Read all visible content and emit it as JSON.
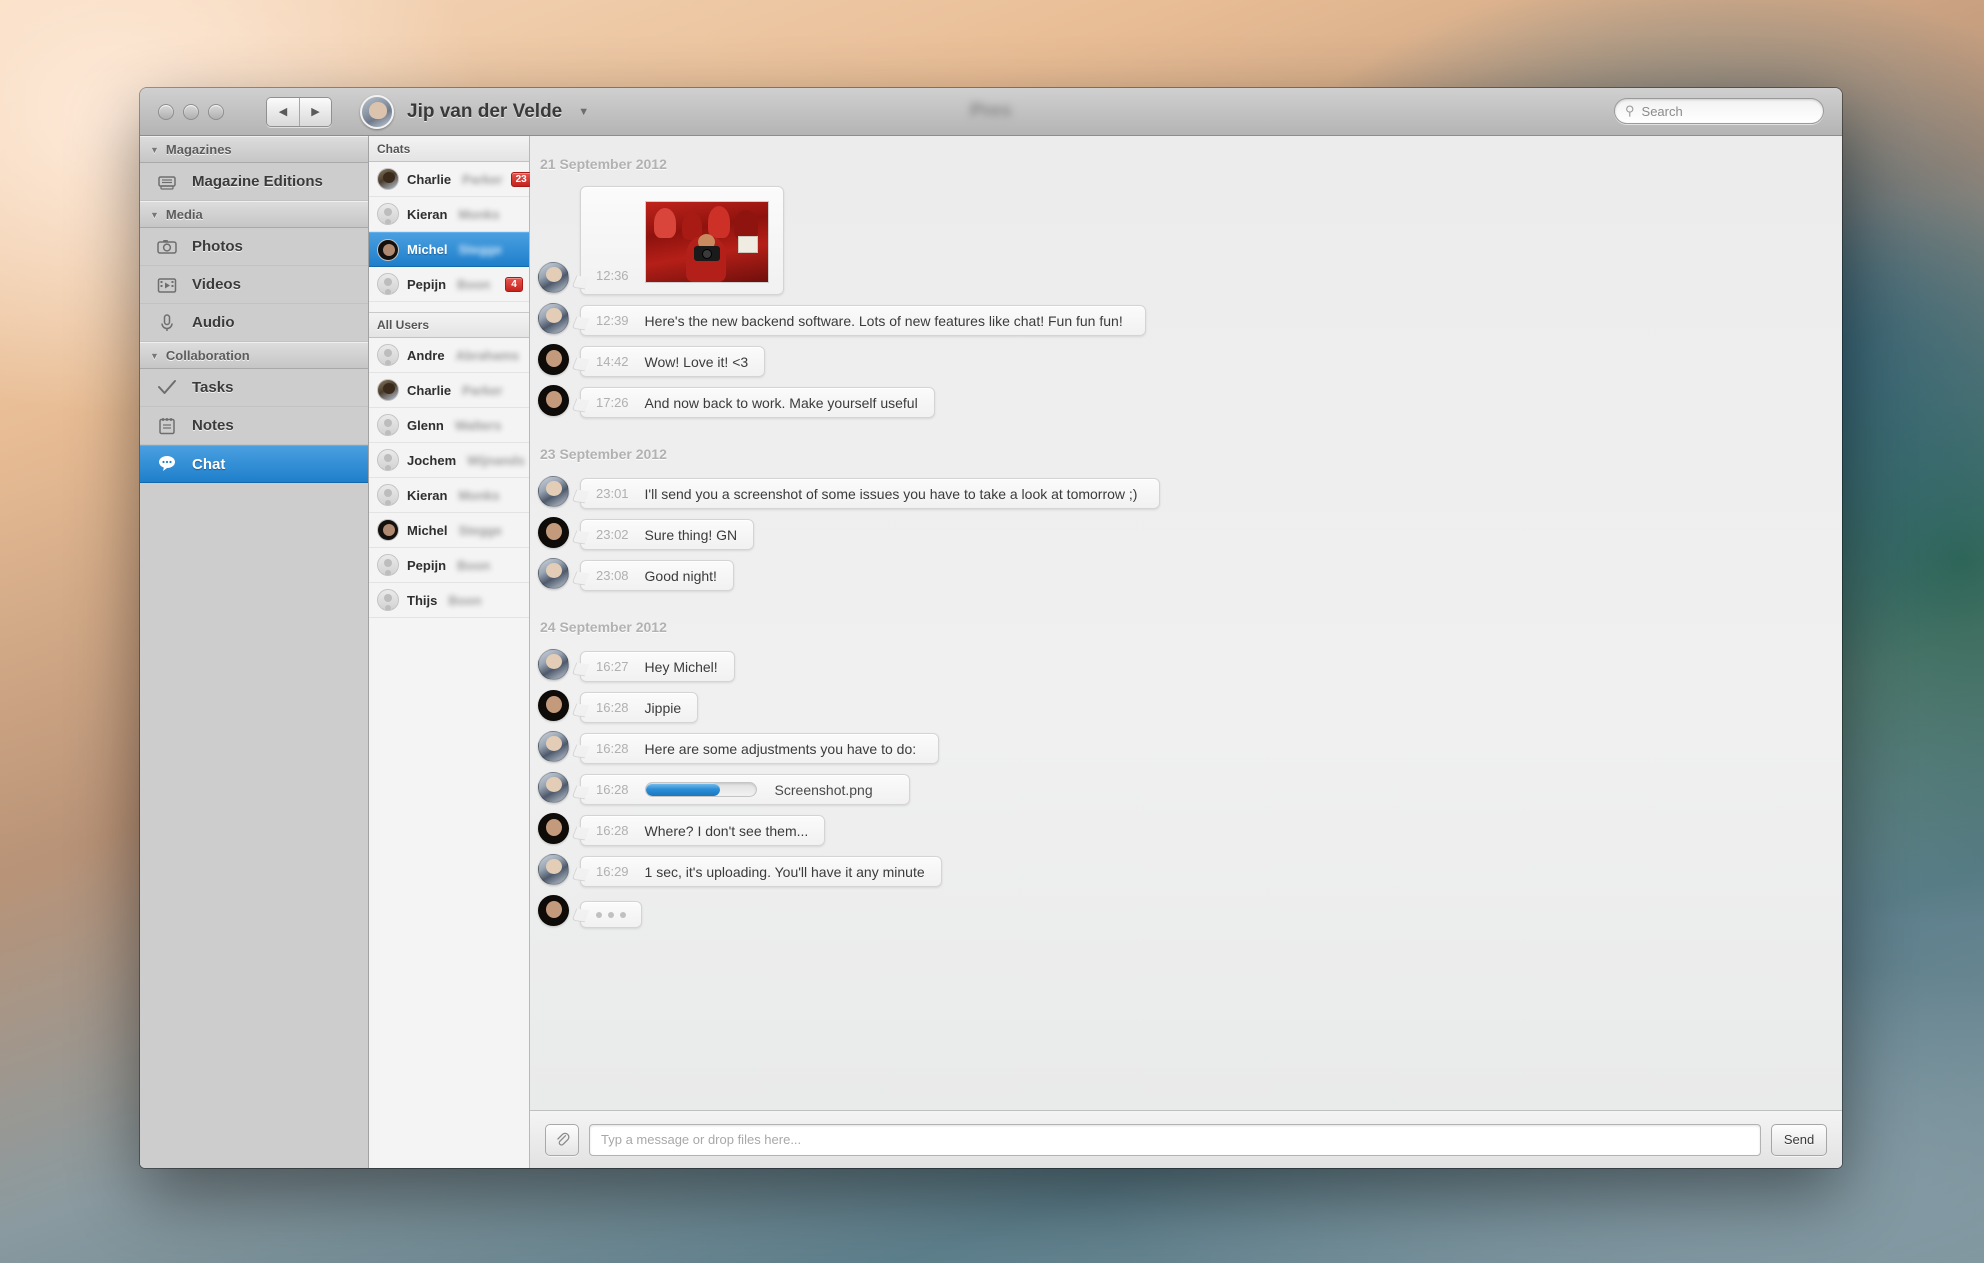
{
  "window": {
    "title": "Pres",
    "title_blurred": true,
    "accent_color": "#1f7fcb",
    "badge_color": "#c5231d"
  },
  "titlebar": {
    "traffic_lights": [
      "close",
      "minimize",
      "zoom"
    ],
    "nav_back": "◀",
    "nav_forward": "▶",
    "user_name": "Jip van der Velde",
    "user_chevron": "▼",
    "search": {
      "placeholder": "Search",
      "value": "",
      "icon": "search-icon"
    }
  },
  "sidebar": {
    "sections": [
      {
        "label": "Magazines",
        "items": [
          {
            "label": "Magazine Editions",
            "icon": "magazine-icon",
            "selected": false
          }
        ]
      },
      {
        "label": "Media",
        "items": [
          {
            "label": "Photos",
            "icon": "camera-icon",
            "selected": false
          },
          {
            "label": "Videos",
            "icon": "film-icon",
            "selected": false
          },
          {
            "label": "Audio",
            "icon": "microphone-icon",
            "selected": false
          }
        ]
      },
      {
        "label": "Collaboration",
        "items": [
          {
            "label": "Tasks",
            "icon": "checkmark-icon",
            "selected": false
          },
          {
            "label": "Notes",
            "icon": "notepad-icon",
            "selected": false
          },
          {
            "label": "Chat",
            "icon": "chat-bubble-icon",
            "selected": true
          }
        ]
      }
    ]
  },
  "chat_list": {
    "chats_header": "Chats",
    "chats": [
      {
        "first": "Charlie",
        "last": "Parker",
        "avatar": "charlie",
        "badge": "23",
        "selected": false
      },
      {
        "first": "Kieran",
        "last": "Monks",
        "avatar": "generic",
        "badge": "",
        "selected": false
      },
      {
        "first": "Michel",
        "last": "Stegge",
        "avatar": "michel",
        "badge": "",
        "selected": true
      },
      {
        "first": "Pepijn",
        "last": "Boon",
        "avatar": "generic",
        "badge": "4",
        "selected": false
      }
    ],
    "all_users_header": "All Users",
    "all_users": [
      {
        "first": "Andre",
        "last": "Abrahams",
        "avatar": "generic"
      },
      {
        "first": "Charlie",
        "last": "Parker",
        "avatar": "charlie"
      },
      {
        "first": "Glenn",
        "last": "Walters",
        "avatar": "generic"
      },
      {
        "first": "Jochem",
        "last": "Wijnands",
        "avatar": "generic"
      },
      {
        "first": "Kieran",
        "last": "Monks",
        "avatar": "generic"
      },
      {
        "first": "Michel",
        "last": "Stegge",
        "avatar": "michel"
      },
      {
        "first": "Pepijn",
        "last": "Boon",
        "avatar": "generic"
      },
      {
        "first": "Thijs",
        "last": "Boon",
        "avatar": "generic"
      }
    ]
  },
  "conversation": {
    "days": [
      {
        "date": "21 September 2012",
        "messages": [
          {
            "time": "12:36",
            "kind": "photo",
            "sender": "jip",
            "text": ""
          },
          {
            "time": "12:39",
            "kind": "text",
            "sender": "jip",
            "text": "Here's the new backend software. Lots of new features like chat! Fun fun fun!"
          },
          {
            "time": "14:42",
            "kind": "text",
            "sender": "michel",
            "text": "Wow! Love it! <3"
          },
          {
            "time": "17:26",
            "kind": "text",
            "sender": "michel",
            "text": "And now back to work. Make yourself useful"
          }
        ]
      },
      {
        "date": "23 September 2012",
        "messages": [
          {
            "time": "23:01",
            "kind": "text",
            "sender": "jip",
            "text": "I'll send you a screenshot of some issues you have to take a look at tomorrow ;)"
          },
          {
            "time": "23:02",
            "kind": "text",
            "sender": "michel",
            "text": "Sure thing! GN"
          },
          {
            "time": "23:08",
            "kind": "text",
            "sender": "jip",
            "text": "Good night!"
          }
        ]
      },
      {
        "date": "24 September 2012",
        "messages": [
          {
            "time": "16:27",
            "kind": "text",
            "sender": "jip",
            "text": "Hey Michel!"
          },
          {
            "time": "16:28",
            "kind": "text",
            "sender": "michel",
            "text": "Jippie"
          },
          {
            "time": "16:28",
            "kind": "text",
            "sender": "jip",
            "text": "Here are some adjustments you have to do:"
          },
          {
            "time": "16:28",
            "kind": "upload",
            "sender": "jip",
            "filename": "Screenshot.png",
            "progress": 68
          },
          {
            "time": "16:28",
            "kind": "text",
            "sender": "michel",
            "text": "Where? I don't see them..."
          },
          {
            "time": "16:29",
            "kind": "text",
            "sender": "jip",
            "text": "1 sec, it's uploading. You'll have it any minute"
          },
          {
            "time": "",
            "kind": "typing",
            "sender": "michel",
            "text": "• • •"
          }
        ]
      }
    ]
  },
  "composer": {
    "attach_icon": "paperclip-icon",
    "input_placeholder": "Typ a message or drop files here...",
    "input_value": "",
    "send_label": "Send"
  }
}
